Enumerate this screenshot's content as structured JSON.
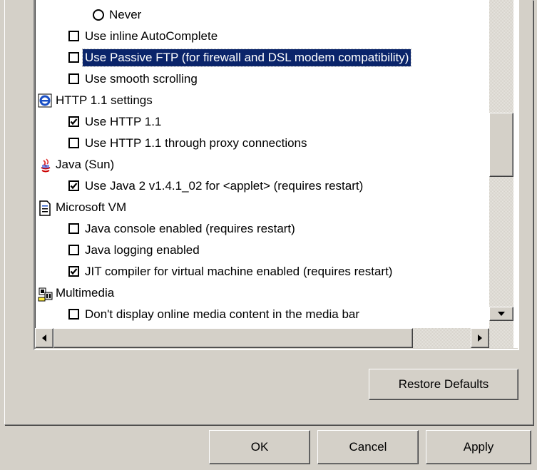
{
  "options_tree": {
    "rows": [
      {
        "type": "radio",
        "label": "Never",
        "checked": false
      },
      {
        "type": "checkbox",
        "label": "Use inline AutoComplete",
        "checked": false
      },
      {
        "type": "checkbox",
        "label": "Use Passive FTP (for firewall and DSL modem compatibility)",
        "checked": false,
        "selected": true
      },
      {
        "type": "checkbox",
        "label": "Use smooth scrolling",
        "checked": false
      },
      {
        "type": "category",
        "label": "HTTP 1.1 settings",
        "icon": "ie-icon"
      },
      {
        "type": "checkbox",
        "label": "Use HTTP 1.1",
        "checked": true
      },
      {
        "type": "checkbox",
        "label": "Use HTTP 1.1 through proxy connections",
        "checked": false
      },
      {
        "type": "category",
        "label": "Java (Sun)",
        "icon": "java-icon"
      },
      {
        "type": "checkbox",
        "label": "Use Java 2 v1.4.1_02 for <applet> (requires restart)",
        "checked": true
      },
      {
        "type": "category",
        "label": "Microsoft VM",
        "icon": "document-icon"
      },
      {
        "type": "checkbox",
        "label": "Java console enabled (requires restart)",
        "checked": false
      },
      {
        "type": "checkbox",
        "label": "Java logging enabled",
        "checked": false
      },
      {
        "type": "checkbox",
        "label": "JIT compiler for virtual machine enabled (requires restart)",
        "checked": true
      },
      {
        "type": "category",
        "label": "Multimedia",
        "icon": "multimedia-icon"
      },
      {
        "type": "checkbox",
        "label": "Don't display online media content in the media bar",
        "checked": false
      }
    ]
  },
  "buttons": {
    "restore_defaults": "Restore Defaults",
    "ok": "OK",
    "cancel": "Cancel",
    "apply": "Apply"
  },
  "colors": {
    "selection": "#0a246a",
    "dialog": "#d4d0c8"
  }
}
